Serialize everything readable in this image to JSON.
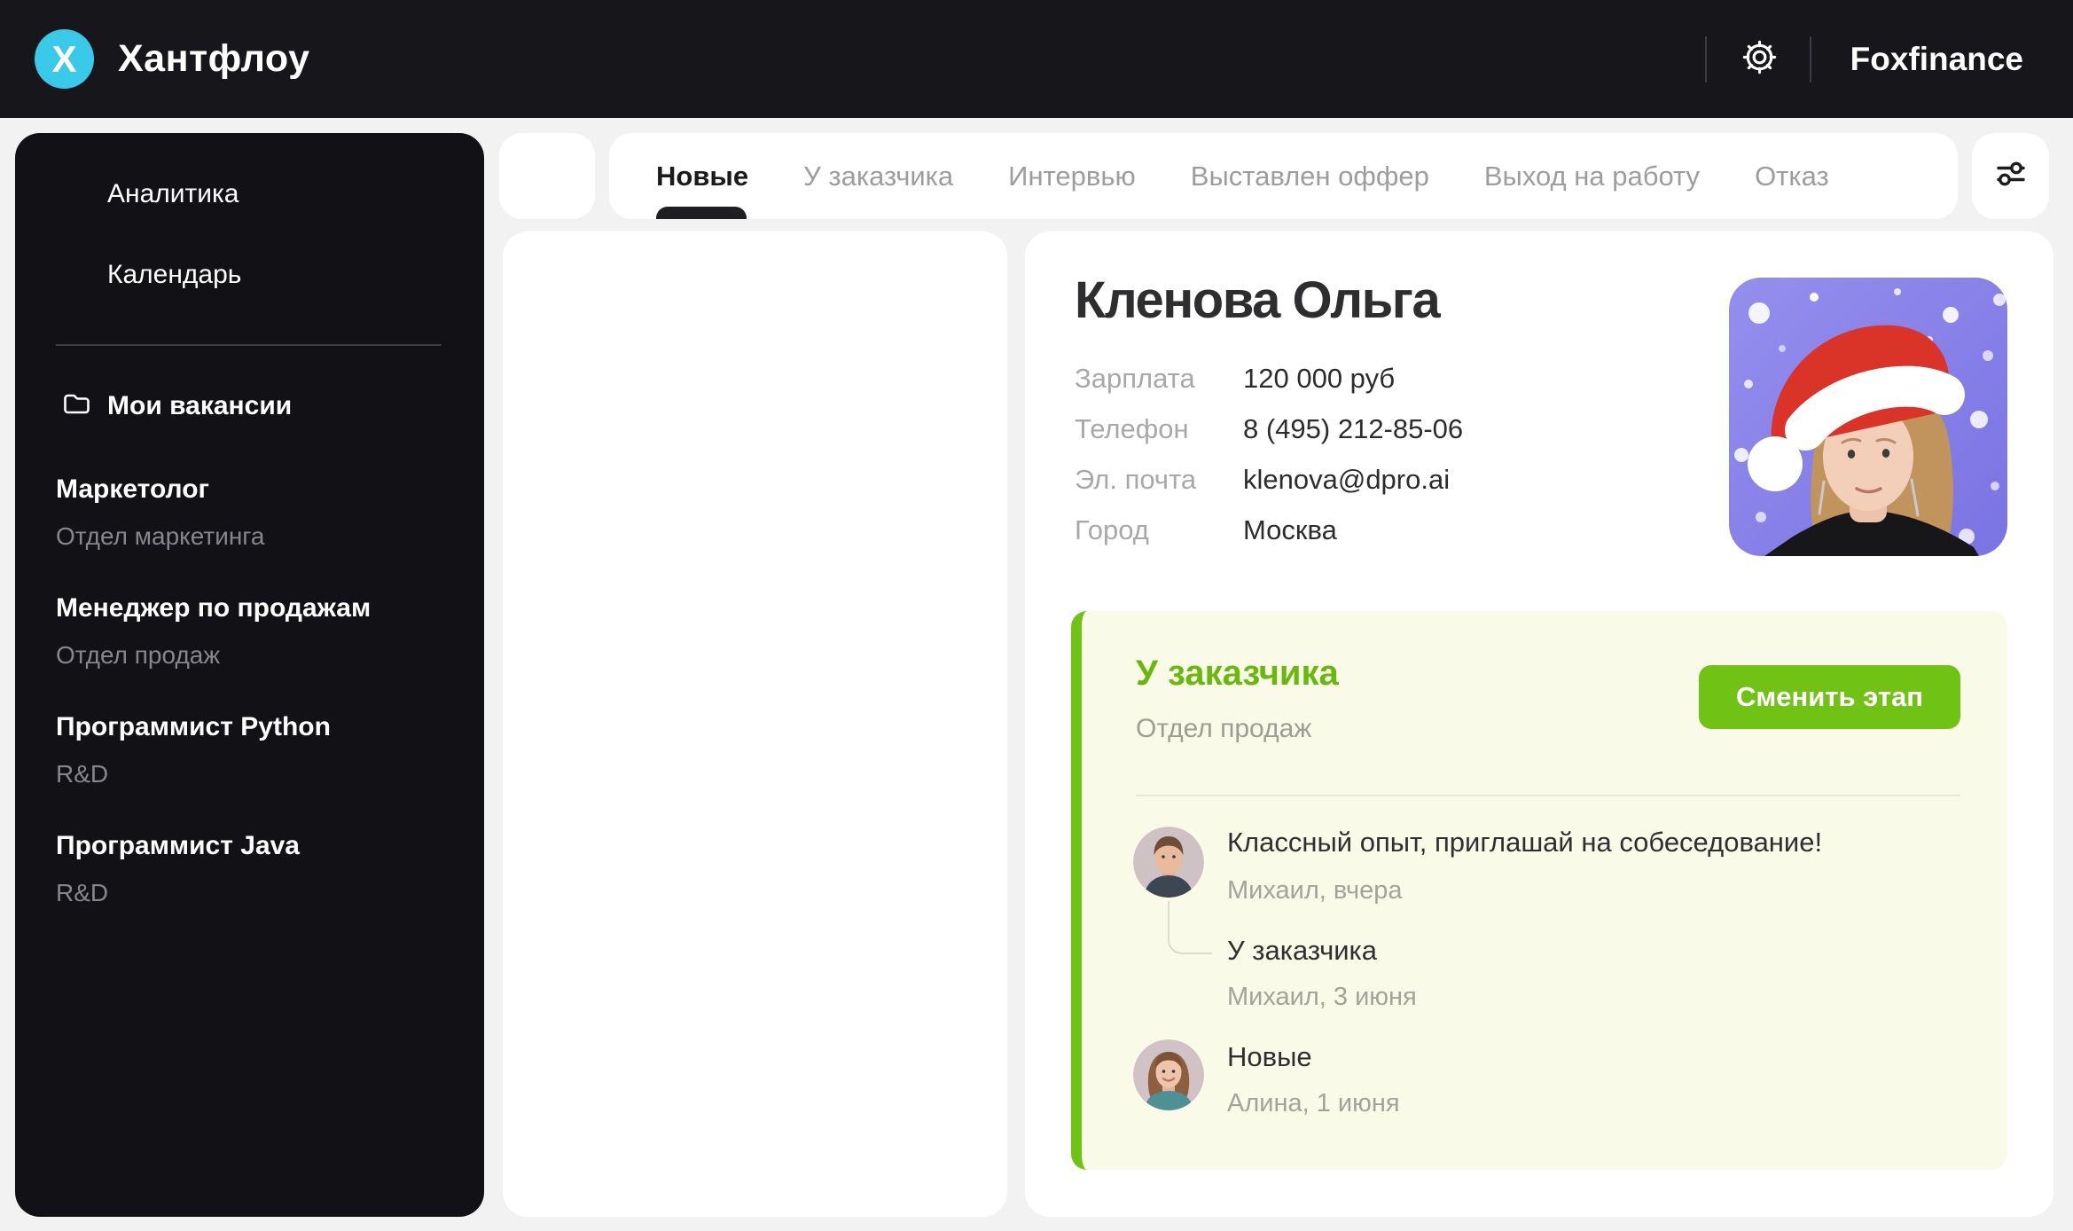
{
  "header": {
    "logo_letter": "Х",
    "brand": "Хантфлоу",
    "account": "Foxfinance"
  },
  "sidebar": {
    "nav": [
      {
        "label": "Аналитика"
      },
      {
        "label": "Календарь"
      }
    ],
    "vacancies_title": "Мои вакансии",
    "vacancies": [
      {
        "title": "Маркетолог",
        "department": "Отдел маркетинга"
      },
      {
        "title": "Менеджер по продажам",
        "department": "Отдел продаж"
      },
      {
        "title": "Программист Python",
        "department": "R&D"
      },
      {
        "title": "Программист Java",
        "department": "R&D"
      }
    ]
  },
  "tabs": {
    "items": [
      {
        "label": "Новые",
        "active": true
      },
      {
        "label": "У заказчика",
        "active": false
      },
      {
        "label": "Интервью",
        "active": false
      },
      {
        "label": "Выставлен оффер",
        "active": false
      },
      {
        "label": "Выход на работу",
        "active": false
      },
      {
        "label": "Отказ",
        "active": false
      }
    ]
  },
  "candidate": {
    "name": "Кленова Ольга",
    "fields": [
      {
        "label": "Зарплата",
        "value": "120 000 руб"
      },
      {
        "label": "Телефон",
        "value": "8 (495) 212-85-06"
      },
      {
        "label": "Эл. почта",
        "value": "klenova@dpro.ai"
      },
      {
        "label": "Город",
        "value": "Москва"
      }
    ]
  },
  "stage": {
    "title": "У заказчика",
    "department": "Отдел продаж",
    "change_button": "Сменить этап",
    "timeline": [
      {
        "text": "Классный опыт, приглашай на собеседование!",
        "meta": "Михаил, вчера",
        "avatar": "male-avatar"
      },
      {
        "text": "У заказчика",
        "meta": "Михаил, 3 июня",
        "avatar": null
      },
      {
        "text": "Новые",
        "meta": "Алина, 1 июня",
        "avatar": "female-avatar"
      }
    ]
  },
  "icons": {
    "settings": "gear-icon",
    "vacancies": "folder-icon",
    "filter": "sliders-icon"
  },
  "colors": {
    "accent_green": "#70c215",
    "green_text": "#68b80e",
    "accent_cyan": "#39c9e9",
    "header_dark": "#16161b",
    "sidebar_dark": "#111116",
    "card_yellow": "#fafae9",
    "page_bg": "#f2f2f3"
  }
}
